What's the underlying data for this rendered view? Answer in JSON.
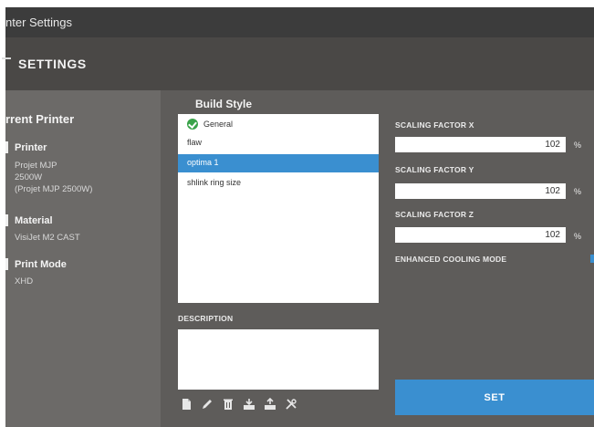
{
  "window": {
    "title": "nter Settings"
  },
  "header": {
    "title": "SETTINGS"
  },
  "current_printer": {
    "title": "rrent Printer",
    "printer_label": "Printer",
    "printer_value_lines": [
      "Projet MJP",
      "2500W",
      "(Projet MJP 2500W)"
    ],
    "material_label": "Material",
    "material_value": "VisiJet M2 CAST",
    "mode_label": "Print Mode",
    "mode_value": "XHD"
  },
  "build_style": {
    "title": "Build Style",
    "items": [
      {
        "label": "General",
        "icon": "check-circle-icon"
      },
      {
        "label": "flaw"
      },
      {
        "label": "optima 1",
        "selected": true
      },
      {
        "label": "shlink ring size"
      }
    ]
  },
  "description": {
    "label": "DESCRIPTION",
    "value": ""
  },
  "toolbar": {
    "icons": [
      "new-icon",
      "edit-icon",
      "delete-icon",
      "import-icon",
      "export-icon",
      "tools-icon"
    ]
  },
  "scaling": {
    "x": {
      "label": "SCALING FACTOR X",
      "value": "102",
      "unit": "%"
    },
    "y": {
      "label": "SCALING FACTOR Y",
      "value": "102",
      "unit": "%"
    },
    "z": {
      "label": "SCALING FACTOR Z",
      "value": "102",
      "unit": "%"
    }
  },
  "enhanced_cooling": {
    "label": "ENHANCED COOLING MODE"
  },
  "actions": {
    "set_label": "SET"
  },
  "colors": {
    "accent": "#3a8fd0",
    "check": "#3aa34a",
    "panel": "#5e5c5a",
    "sidebar": "#6c6a68",
    "header": "#4a4846",
    "titlebar": "#3c3c3c"
  }
}
